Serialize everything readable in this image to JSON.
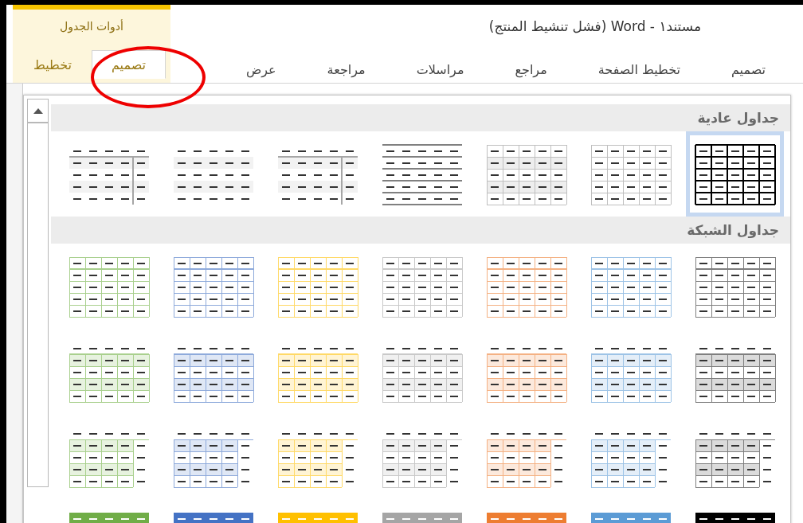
{
  "window": {
    "title": "مستند١ - Word (فشل تنشيط المنتج)"
  },
  "tool_group": {
    "label": "أدوات الجدول"
  },
  "tabs": [
    {
      "label": "تصميم",
      "selected": false,
      "contextual": false
    },
    {
      "label": "تخطيط الصفحة",
      "selected": false,
      "contextual": false
    },
    {
      "label": "مراجع",
      "selected": false,
      "contextual": false
    },
    {
      "label": "مراسلات",
      "selected": false,
      "contextual": false
    },
    {
      "label": "مراجعة",
      "selected": false,
      "contextual": false
    },
    {
      "label": "عرض",
      "selected": false,
      "contextual": false
    },
    {
      "label": "تصميم",
      "selected": true,
      "contextual": true
    },
    {
      "label": "تخطيط",
      "selected": false,
      "contextual": true
    }
  ],
  "gallery": {
    "sections": [
      {
        "title": "جداول عادية",
        "styles": [
          {
            "kind": "grid-black",
            "selected": true
          },
          {
            "kind": "grid-light",
            "selected": false
          },
          {
            "kind": "grid-banded",
            "selected": false
          },
          {
            "kind": "lines",
            "selected": false
          },
          {
            "kind": "column-banded",
            "selected": false
          },
          {
            "kind": "banded",
            "selected": false
          },
          {
            "kind": "column-banded",
            "selected": false
          }
        ]
      },
      {
        "title": "جداول الشبكة",
        "styles": [
          {
            "kind": "header-line",
            "color": "#7f7f7f",
            "selected": false
          },
          {
            "kind": "header-line",
            "color": "#9dc3e6",
            "selected": false
          },
          {
            "kind": "header-line",
            "color": "#f4b183",
            "selected": false
          },
          {
            "kind": "header-line",
            "color": "#c9c9c9",
            "selected": false
          },
          {
            "kind": "header-line",
            "color": "#ffd966",
            "selected": false
          },
          {
            "kind": "header-line",
            "color": "#8eaadb",
            "selected": false
          },
          {
            "kind": "header-line",
            "color": "#a9d08e",
            "selected": false
          },
          {
            "kind": "banded-grid",
            "color": "#7f7f7f",
            "selected": false
          },
          {
            "kind": "banded-grid",
            "color": "#9dc3e6",
            "selected": false
          },
          {
            "kind": "banded-grid",
            "color": "#f4b183",
            "selected": false
          },
          {
            "kind": "banded-grid",
            "color": "#c9c9c9",
            "selected": false
          },
          {
            "kind": "banded-grid",
            "color": "#ffd966",
            "selected": false
          },
          {
            "kind": "banded-grid",
            "color": "#8eaadb",
            "selected": false
          },
          {
            "kind": "banded-grid",
            "color": "#a9d08e",
            "selected": false
          },
          {
            "kind": "open-grid",
            "color": "#7f7f7f",
            "selected": false
          },
          {
            "kind": "open-grid",
            "color": "#9dc3e6",
            "selected": false
          },
          {
            "kind": "open-grid",
            "color": "#f4b183",
            "selected": false
          },
          {
            "kind": "open-grid",
            "color": "#c9c9c9",
            "selected": false
          },
          {
            "kind": "open-grid",
            "color": "#ffd966",
            "selected": false
          },
          {
            "kind": "open-grid",
            "color": "#8eaadb",
            "selected": false
          },
          {
            "kind": "open-grid",
            "color": "#a9d08e",
            "selected": false
          },
          {
            "kind": "filled-header",
            "color": "#000000",
            "selected": false
          },
          {
            "kind": "filled-header",
            "color": "#5b9bd5",
            "selected": false
          },
          {
            "kind": "filled-header",
            "color": "#ed7d31",
            "selected": false
          },
          {
            "kind": "filled-header",
            "color": "#a5a5a5",
            "selected": false
          },
          {
            "kind": "filled-header",
            "color": "#ffc000",
            "selected": false
          },
          {
            "kind": "filled-header",
            "color": "#4472c4",
            "selected": false
          },
          {
            "kind": "filled-header",
            "color": "#70ad47",
            "selected": false
          }
        ]
      }
    ]
  }
}
